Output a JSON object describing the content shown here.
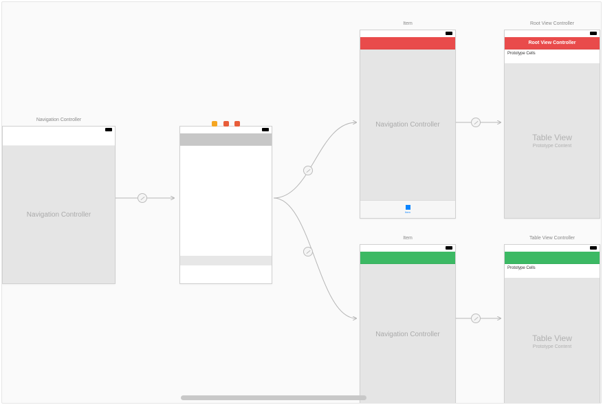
{
  "scenes": {
    "nav1": {
      "title": "Navigation Controller",
      "content_label": "Navigation Controller"
    },
    "tabvc": {
      "tab_item_label": "Item"
    },
    "nav_red": {
      "title": "Item",
      "content_label": "Navigation Controller"
    },
    "nav_green": {
      "title": "Item",
      "content_label": "Navigation Controller"
    },
    "root_red": {
      "title": "Root View Controller",
      "nav_title": "Root View Controller",
      "proto_label": "Prototype Cells",
      "tv_title": "Table View",
      "tv_sub": "Prototype Content"
    },
    "root_green": {
      "title": "Table View Controller",
      "proto_label": "Prototype Cells",
      "tv_title": "Table View",
      "tv_sub": "Prototype Content"
    }
  },
  "colors": {
    "red": "#e94b4b",
    "green": "#3cb964"
  }
}
